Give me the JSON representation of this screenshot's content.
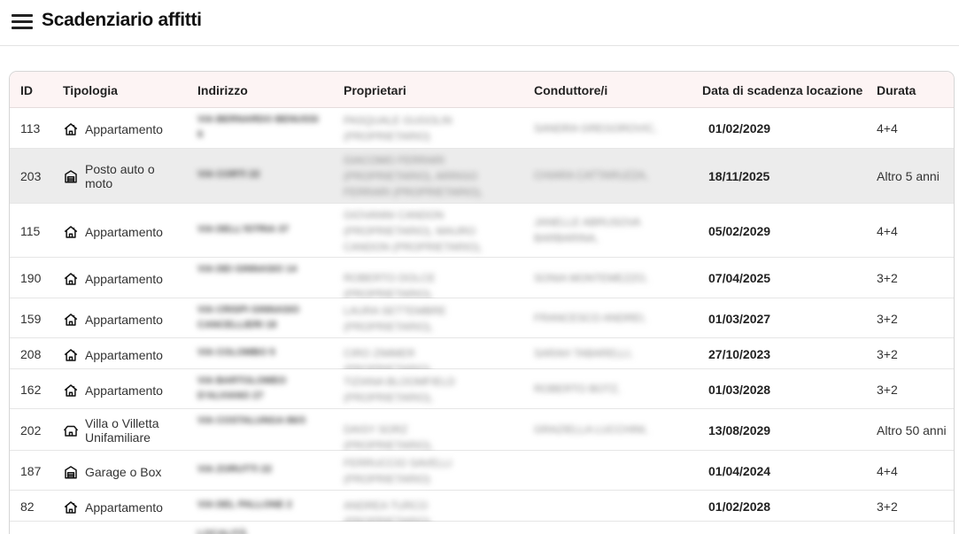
{
  "header": {
    "title": "Scadenziario affitti",
    "menu_icon": "hamburger-menu-icon"
  },
  "table": {
    "columns": {
      "id": "ID",
      "type": "Tipologia",
      "address": "Indirizzo",
      "owners": "Proprietari",
      "tenants": "Conduttore/i",
      "expiry": "Data di scadenza locazione",
      "duration": "Durata"
    },
    "rows": [
      {
        "id": "113",
        "type": "Appartamento",
        "icon": "house-icon",
        "address": "via Bernardo Benussi 6",
        "owners": "Pasquale Gugolin (Proprietario)",
        "tenants": "Sandra Gregorovic,",
        "expiry": "01/02/2029",
        "duration": "4+4"
      },
      {
        "id": "203",
        "type": "Posto auto o moto",
        "icon": "parking-garage-icon",
        "address": "Via Corti 22",
        "owners": "Giacomo Ferrari (Proprietario), Arrigo Ferrari (Proprietario),",
        "tenants": "Chiara Cattaruzza,",
        "expiry": "18/11/2025",
        "duration": "Altro 5 anni"
      },
      {
        "id": "115",
        "type": "Appartamento",
        "icon": "house-icon",
        "address": "Via dell'Istria 37",
        "owners": "Giovanni Candon (Proprietario), Mauro Candon (Proprietario),",
        "tenants": "Janelle Abrusova Barbarina,",
        "expiry": "05/02/2029",
        "duration": "4+4"
      },
      {
        "id": "190",
        "type": "Appartamento",
        "icon": "house-icon",
        "address": "Via dei Ginnasio 14",
        "owners": "Roberto Dolce (Proprietario),",
        "tenants": "Sonia Montemezzo,",
        "expiry": "07/04/2025",
        "duration": "3+2"
      },
      {
        "id": "159",
        "type": "Appartamento",
        "icon": "house-icon",
        "address": "Via Crispi Ginnasio Cancellieri 18",
        "owners": "Laura Settembre (Proprietario),",
        "tenants": "Francesco Andrei,",
        "expiry": "01/03/2027",
        "duration": "3+2"
      },
      {
        "id": "208",
        "type": "Appartamento",
        "icon": "house-icon",
        "address": "Via Colombo 5",
        "owners": "Ciro Zimmer (Proprietario),",
        "tenants": "Sarah Tabarelli,",
        "expiry": "27/10/2023",
        "duration": "3+2"
      },
      {
        "id": "162",
        "type": "Appartamento",
        "icon": "house-icon",
        "address": "Via Bartolomeo d'Alviano 27",
        "owners": "Tiziana Bloomfield (Proprietario),",
        "tenants": "Roberto Botz,",
        "expiry": "01/03/2028",
        "duration": "3+2"
      },
      {
        "id": "202",
        "type": "Villa o Villetta Unifamiliare",
        "icon": "villa-icon",
        "address": "Via Costalunga 86/3",
        "owners": "Daisy Sorz (Proprietario),",
        "tenants": "Graziella Lucchini,",
        "expiry": "13/08/2029",
        "duration": "Altro 50 anni"
      },
      {
        "id": "187",
        "type": "Garage o Box",
        "icon": "garage-icon",
        "address": "Via Zorutti 22",
        "owners": "Ferruccio Savelli (Proprietario)",
        "tenants": "",
        "expiry": "01/04/2024",
        "duration": "4+4"
      },
      {
        "id": "82",
        "type": "Appartamento",
        "icon": "house-icon",
        "address": "Via del Pallone 2",
        "owners": "Andrea Turco (Proprietario),",
        "tenants": "",
        "expiry": "01/02/2028",
        "duration": "3+2"
      },
      {
        "id": "",
        "type": "",
        "icon": "",
        "address": "Località",
        "owners": "",
        "tenants": "",
        "expiry": "",
        "duration": ""
      }
    ]
  },
  "colors": {
    "header_bg": "#fdf4f4",
    "selected_row_bg": "#ececec",
    "border": "#d6d6d6"
  }
}
